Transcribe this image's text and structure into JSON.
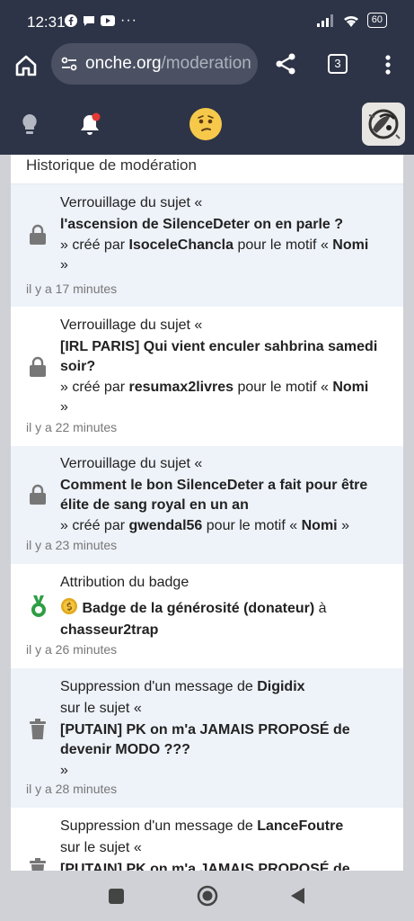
{
  "status": {
    "time": "12:31",
    "battery": "60"
  },
  "browser": {
    "url_host": "onche.org",
    "url_path": "/moderation",
    "tab_count": "3"
  },
  "panel": {
    "title": "Historique de modération",
    "entries": [
      {
        "icon": "lock-icon",
        "action": "Verrouillage du sujet «",
        "subject": "l'ascension de SilenceDeter on en parle ?",
        "created_by_prefix": "» créé par",
        "author": "IsoceleChancla",
        "reason_prefix": "pour le motif «",
        "reason": "Nomi",
        "close": "»",
        "time": "il y a 17 minutes"
      },
      {
        "icon": "lock-icon",
        "action": "Verrouillage du sujet «",
        "subject": "[IRL PARIS] Qui vient enculer sahbrina samedi soir?",
        "created_by_prefix": "» créé par",
        "author": "resumax2livres",
        "reason_prefix": "pour le motif «",
        "reason": "Nomi",
        "close": "»",
        "time": "il y a 22 minutes"
      },
      {
        "icon": "lock-icon",
        "action": "Verrouillage du sujet «",
        "subject": "Comment le bon SilenceDeter a fait pour être élite de sang royal en un an",
        "created_by_prefix": "» créé par",
        "author": "gwendal56",
        "reason_prefix": "pour le motif «",
        "reason": "Nomi",
        "close": "»",
        "time": "il y a 23 minutes"
      },
      {
        "icon": "badge-medal-icon",
        "action": "Attribution du badge",
        "badge_name": "Badge de la générosité (donateur)",
        "badge_suffix": "à",
        "recipient": "chasseur2trap",
        "time": "il y a 26 minutes"
      },
      {
        "icon": "trash-icon",
        "action_prefix": "Suppression d'un message de",
        "author": "Digidix",
        "subject_prefix": "sur le sujet «",
        "subject": "[PUTAIN] PK on m'a JAMAIS PROPOSÉ de devenir MODO ???",
        "close": "»",
        "time": "il y a 28 minutes"
      },
      {
        "icon": "trash-icon",
        "action_prefix": "Suppression d'un message de",
        "author": "LanceFoutre",
        "subject_prefix": "sur le sujet «",
        "subject": "[PUTAIN] PK on m'a JAMAIS PROPOSÉ de devenir MODO ???"
      }
    ]
  },
  "colors": {
    "chrome": "#2e3447",
    "accent_badge": "#2e9e44",
    "notification_dot": "#e53935",
    "shaded_row": "#eef2f9"
  }
}
